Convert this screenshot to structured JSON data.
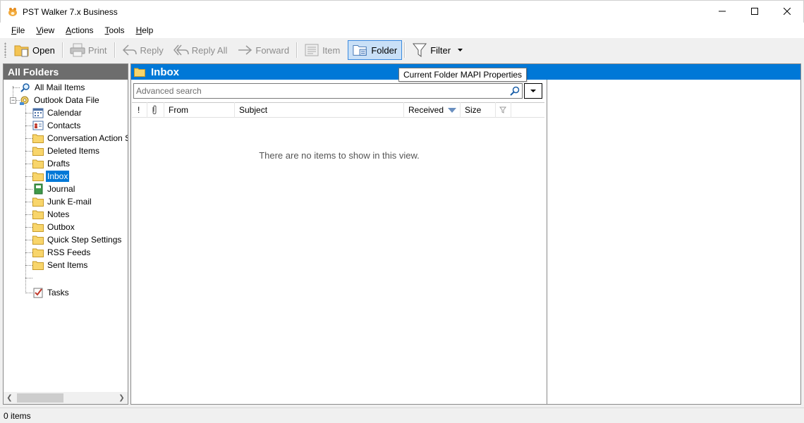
{
  "window": {
    "title": "PST Walker 7.x Business",
    "app_icon": "pst-walker-logo-icon"
  },
  "menu": [
    {
      "accel": "F",
      "rest": "ile"
    },
    {
      "accel": "V",
      "rest": "iew"
    },
    {
      "accel": "A",
      "rest": "ctions"
    },
    {
      "accel": "T",
      "rest": "ools"
    },
    {
      "accel": "H",
      "rest": "elp"
    }
  ],
  "toolbar": {
    "open": "Open",
    "print": "Print",
    "reply": "Reply",
    "reply_all": "Reply All",
    "forward": "Forward",
    "item": "Item",
    "folder": "Folder",
    "filter": "Filter"
  },
  "tooltip": "Current Folder MAPI Properties",
  "left_panel": {
    "header": "All Folders",
    "root_items": [
      {
        "label": "All Mail Items",
        "icon": "search-icon"
      },
      {
        "label": "Outlook Data File",
        "icon": "data-file-icon"
      }
    ],
    "folders": [
      {
        "label": "Calendar",
        "icon": "calendar-icon"
      },
      {
        "label": "Contacts",
        "icon": "contacts-icon"
      },
      {
        "label": "Conversation Action Settings",
        "icon": "folder-icon"
      },
      {
        "label": "Deleted Items",
        "icon": "folder-icon"
      },
      {
        "label": "Drafts",
        "icon": "folder-icon"
      },
      {
        "label": "Inbox",
        "icon": "folder-icon",
        "selected": true
      },
      {
        "label": "Journal",
        "icon": "journal-icon"
      },
      {
        "label": "Junk E-mail",
        "icon": "folder-icon"
      },
      {
        "label": "Notes",
        "icon": "folder-icon"
      },
      {
        "label": "Outbox",
        "icon": "folder-icon"
      },
      {
        "label": "Quick Step Settings",
        "icon": "folder-icon"
      },
      {
        "label": "RSS Feeds",
        "icon": "folder-icon"
      },
      {
        "label": "Sent Items",
        "icon": "folder-icon"
      },
      {
        "label": "Tasks",
        "icon": "tasks-icon"
      }
    ]
  },
  "main": {
    "folder_title": "Inbox",
    "search_placeholder": "Advanced search",
    "columns": {
      "importance": "!",
      "attachment": "attachment-icon",
      "from": "From",
      "subject": "Subject",
      "received": "Received",
      "size": "Size",
      "flag": "flag-icon"
    },
    "empty_message": "There are no items to show in this view."
  },
  "status": {
    "text": "0 items"
  },
  "colors": {
    "accent": "#0078d7",
    "header_gray": "#6d6d6d",
    "active_button": "#c9e0f7"
  }
}
